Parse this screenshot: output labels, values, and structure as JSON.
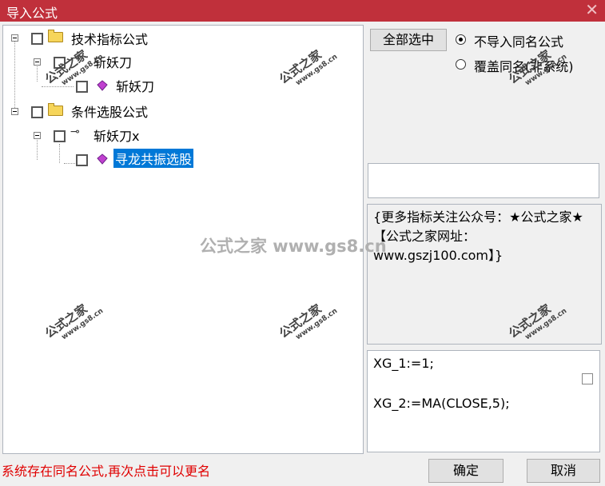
{
  "window": {
    "title": "导入公式",
    "close_glyph": "✕"
  },
  "tree": {
    "nodes": [
      {
        "label": "技术指标公式",
        "type": "folder",
        "expanded": true
      },
      {
        "label": "斩妖刀",
        "type": "key",
        "expanded": true
      },
      {
        "label": "斩妖刀",
        "type": "gem"
      },
      {
        "label": "条件选股公式",
        "type": "folder",
        "expanded": true
      },
      {
        "label": "斩妖刀x",
        "type": "key",
        "expanded": true
      },
      {
        "label": "寻龙共振选股",
        "type": "gem",
        "selected": true
      }
    ]
  },
  "options": {
    "select_all_label": "全部选中",
    "radio_no_import": "不导入同名公式",
    "radio_overwrite": "覆盖同名(非系统)",
    "selected_radio": "no_import"
  },
  "description": "{更多指标关注公众号：★公式之家★ 【公式之家网址：www.gszj100.com】}",
  "code": {
    "lines": [
      "XG_1:=1;",
      "",
      "XG_2:=MA(CLOSE,5);"
    ]
  },
  "status_message": "系统存在同名公式,再次点击可以更名",
  "buttons": {
    "ok": "确定",
    "cancel": "取消"
  },
  "watermark": {
    "text": "公式之家",
    "url": "www.gs8.cn",
    "center": "公式之家 www.gs8.cn"
  },
  "colors": {
    "title_bar": "#c0303b",
    "selection": "#0078d7",
    "status_text": "#e00000"
  }
}
